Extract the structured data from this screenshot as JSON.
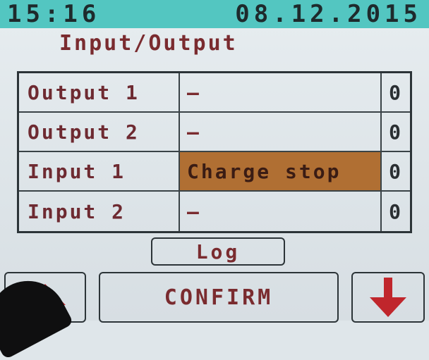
{
  "status_bar": {
    "time": "15:16",
    "date": "08.12.2015"
  },
  "page_title": "Input/Output",
  "io_table": {
    "rows": [
      {
        "name": "Output 1",
        "value": "–",
        "count": "0",
        "active": false
      },
      {
        "name": "Output 2",
        "value": "–",
        "count": "0",
        "active": false
      },
      {
        "name": "Input 1",
        "value": "Charge stop",
        "count": "0",
        "active": true
      },
      {
        "name": "Input 2",
        "value": "–",
        "count": "0",
        "active": false
      }
    ]
  },
  "log_button": {
    "label": "Log"
  },
  "confirm_button": {
    "label": "CONFIRM"
  },
  "icons": {
    "back": "back-arrow-icon",
    "down": "down-arrow-icon"
  },
  "colors": {
    "status_bar": "#53c6c1",
    "active_cell": "#b06f33",
    "text": "#7a2b2f",
    "arrow": "#c0262c"
  }
}
